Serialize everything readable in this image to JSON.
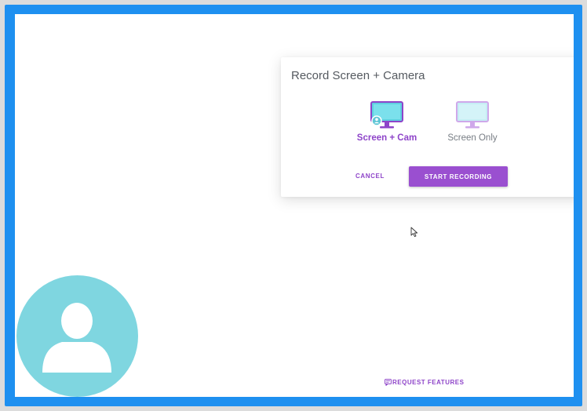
{
  "dialog": {
    "title": "Record Screen + Camera",
    "options": [
      {
        "label": "Screen + Cam",
        "icon": "monitor-camera-icon",
        "selected": true
      },
      {
        "label": "Screen Only",
        "icon": "monitor-icon",
        "selected": false
      }
    ],
    "cancel_label": "CANCEL",
    "start_label": "START RECORDING"
  },
  "footer": {
    "request_label": "REQUEST FEATURES",
    "request_icon": "feedback-icon"
  },
  "avatar": {
    "icon": "user-silhouette-icon"
  },
  "colors": {
    "accent": "#9a4fd0",
    "border": "#1e90f0",
    "avatar": "#7fd6e0"
  }
}
